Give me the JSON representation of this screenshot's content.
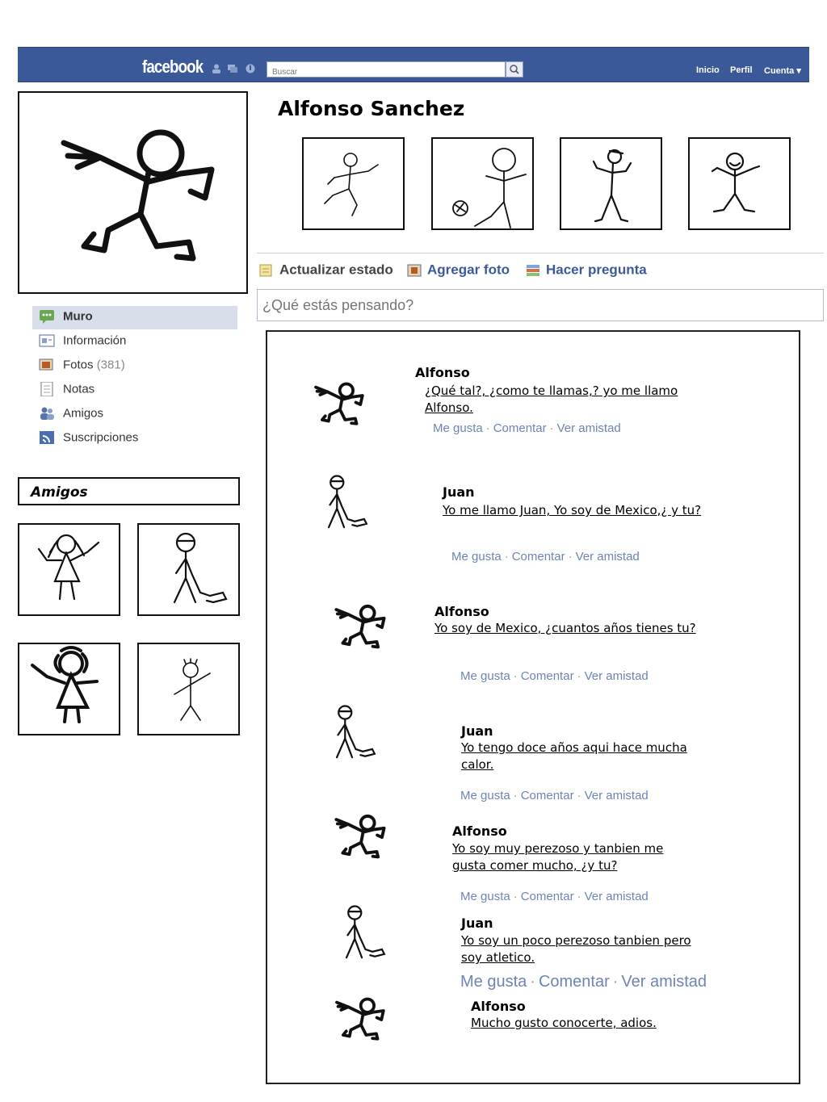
{
  "header": {
    "logo": "facebook",
    "search_placeholder": "Buscar",
    "nav": [
      "Inicio",
      "Perfil",
      "Cuenta ▾"
    ],
    "bar_color": "#3b5998"
  },
  "profile": {
    "name": "Alfonso Sanchez",
    "actions": [
      "Actualizar estado",
      "Agregar foto",
      "Hacer pregunta"
    ],
    "status_placeholder": "¿Qué estás pensando?"
  },
  "sidebar": {
    "items": [
      {
        "label": "Muro",
        "icon": "wall-icon",
        "active": true
      },
      {
        "label": "Información",
        "icon": "info-icon"
      },
      {
        "label": "Fotos",
        "count": "(381)",
        "icon": "photos-icon"
      },
      {
        "label": "Notas",
        "icon": "notes-icon"
      },
      {
        "label": "Amigos",
        "icon": "friends-icon"
      },
      {
        "label": "Suscripciones",
        "icon": "subscriptions-icon"
      }
    ],
    "friends_title": "Amigos"
  },
  "wall": {
    "action_labels": {
      "like": "Me gusta",
      "comment": "Comentar",
      "friendship": "Ver amistad",
      "sep": "·"
    },
    "posts": [
      {
        "author": "Alfonso",
        "text": "¿Qué tal?, ¿como te llamas,? yo me llamo Alfonso."
      },
      {
        "author": "Juan",
        "text": "Yo me llamo Juan, Yo soy de Mexico,¿ y tu?"
      },
      {
        "author": "Alfonso",
        "text": "Yo soy de Mexico, ¿cuantos años tienes tu?"
      },
      {
        "author": "Juan",
        "text": "Yo tengo doce años aqui hace mucha calor."
      },
      {
        "author": "Alfonso",
        "text": "Yo soy muy perezoso y tanbien me gusta comer mucho, ¿y tu?"
      },
      {
        "author": "Juan",
        "text": "Yo soy un poco perezoso tanbien pero soy atletico."
      },
      {
        "author": "Alfonso",
        "text": "Mucho gusto conocerte, adios."
      }
    ]
  }
}
